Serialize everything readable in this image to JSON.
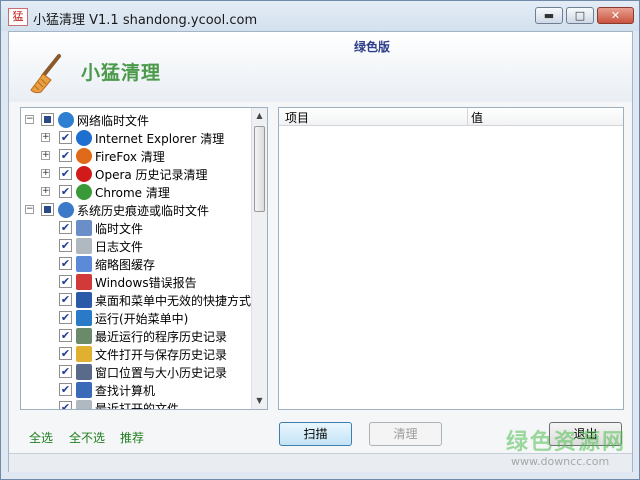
{
  "window": {
    "title": "小猛清理 V1.1 shandong.ycool.com",
    "app_icon_glyph": "猛",
    "controls": {
      "minimize": "▬",
      "maximize": "□",
      "close": "✕"
    }
  },
  "header": {
    "edition_badge": "绿色版",
    "app_name": "小猛清理",
    "logo_icon": "broom-icon"
  },
  "tree": {
    "items": [
      {
        "label": "网络临时文件",
        "level": 0,
        "expander": "−",
        "checked": "partial",
        "icon": "globe-icon",
        "icon_color": "#2f7fd0"
      },
      {
        "label": "Internet Explorer 清理",
        "level": 1,
        "expander": "+",
        "checked": "true",
        "icon": "ie-icon",
        "icon_color": "#1e6fd0"
      },
      {
        "label": "FireFox 清理",
        "level": 1,
        "expander": "+",
        "checked": "true",
        "icon": "firefox-icon",
        "icon_color": "#e06a1a"
      },
      {
        "label": "Opera 历史记录清理",
        "level": 1,
        "expander": "+",
        "checked": "true",
        "icon": "opera-icon",
        "icon_color": "#d11a1a"
      },
      {
        "label": "Chrome 清理",
        "level": 1,
        "expander": "+",
        "checked": "true",
        "icon": "chrome-icon",
        "icon_color": "#3a9a3a"
      },
      {
        "label": "系统历史痕迹或临时文件",
        "level": 0,
        "expander": "−",
        "checked": "partial",
        "icon": "windows-icon",
        "icon_color": "#3a7ac8"
      },
      {
        "label": "临时文件",
        "level": 2,
        "expander": "",
        "checked": "true",
        "icon": "temp-file-icon",
        "icon_color": "#6a8fc8"
      },
      {
        "label": "日志文件",
        "level": 2,
        "expander": "",
        "checked": "true",
        "icon": "log-file-icon",
        "icon_color": "#b0b8c0"
      },
      {
        "label": "缩略图缓存",
        "level": 2,
        "expander": "",
        "checked": "true",
        "icon": "thumbnail-icon",
        "icon_color": "#5a8ad8"
      },
      {
        "label": "Windows错误报告",
        "level": 2,
        "expander": "",
        "checked": "true",
        "icon": "error-report-icon",
        "icon_color": "#d23a3a"
      },
      {
        "label": "桌面和菜单中无效的快捷方式",
        "level": 2,
        "expander": "",
        "checked": "true",
        "icon": "desktop-icon",
        "icon_color": "#2a5aa8"
      },
      {
        "label": "运行(开始菜单中)",
        "level": 2,
        "expander": "",
        "checked": "true",
        "icon": "run-icon",
        "icon_color": "#2a7ac8"
      },
      {
        "label": "最近运行的程序历史记录",
        "level": 2,
        "expander": "",
        "checked": "true",
        "icon": "program-history-icon",
        "icon_color": "#6a8a6a"
      },
      {
        "label": "文件打开与保存历史记录",
        "level": 2,
        "expander": "",
        "checked": "true",
        "icon": "folder-icon",
        "icon_color": "#e0b030"
      },
      {
        "label": "窗口位置与大小历史记录",
        "level": 2,
        "expander": "",
        "checked": "true",
        "icon": "window-icon",
        "icon_color": "#5a6a8a"
      },
      {
        "label": "查找计算机",
        "level": 2,
        "expander": "",
        "checked": "true",
        "icon": "search-computer-icon",
        "icon_color": "#3a6ab8"
      },
      {
        "label": "最近打开的文件",
        "level": 2,
        "expander": "",
        "checked": "true",
        "icon": "recent-file-icon",
        "icon_color": "#b0b8c0"
      }
    ],
    "scroll_up": "▲",
    "scroll_down": "▼"
  },
  "list": {
    "columns": [
      "项目",
      "值"
    ]
  },
  "footer_links": {
    "select_all": "全选",
    "select_none": "全不选",
    "recommend": "推荐"
  },
  "buttons": {
    "scan": "扫描",
    "clean": "清理",
    "exit": "退出"
  },
  "watermark": {
    "text": "绿色资源网",
    "url": "www.downcc.com"
  }
}
